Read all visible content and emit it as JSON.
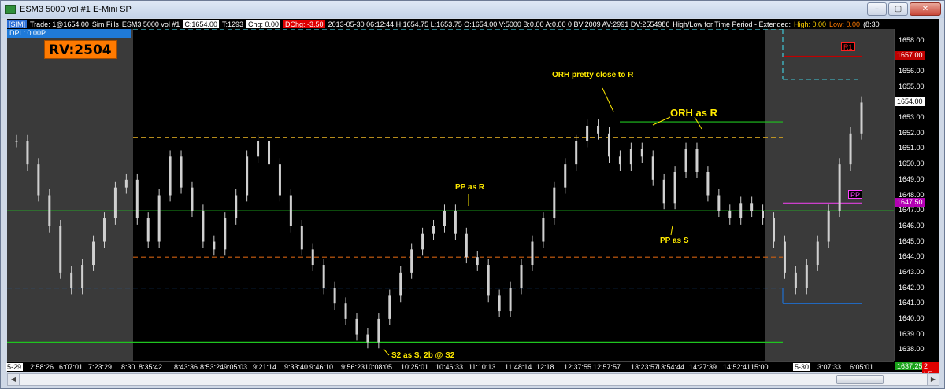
{
  "window": {
    "title": "ESM3  5000 vol  #1  E-Mini SP",
    "buttons": {
      "minimize": "–",
      "maximize": "▢",
      "close": "✕"
    }
  },
  "infobar": {
    "sim": "[SIM]",
    "trade": "Trade: 1@1654.00",
    "fills": "Sim Fills",
    "symbol": "ESM3  5000 vol  #1",
    "close": "C:1654.00",
    "ticks": "T:1293",
    "chg": "Chg: 0.00",
    "dchg": "DChg: -3.50",
    "bar": "2013-05-30 06:12:44 H:1654.75 L:1653.75 O:1654.00 V:5000 B:0.00 A:0.00 0 BV:2009 AV:2991 DV:2554986",
    "hl_label": "High/Low for Time Period - Extended:",
    "high": "High: 0.00",
    "low": "Low: 0.00",
    "tail": "(8:30"
  },
  "dpl": "DPL: 0.00P",
  "rv_badge": "RV:2504",
  "price_axis": {
    "labels": [
      "1658.00",
      "1656.00",
      "1655.00",
      "1653.00",
      "1652.00",
      "1651.00",
      "1650.00",
      "1649.00",
      "1648.00",
      "1647.00",
      "1646.00",
      "1645.00",
      "1644.00",
      "1643.00",
      "1642.00",
      "1641.00",
      "1640.00",
      "1639.00",
      "1638.00"
    ],
    "tags": [
      {
        "name": "r1-tag",
        "text": "R1",
        "color": "#ff2020",
        "bg": "#000"
      },
      {
        "name": "r1-price-tag",
        "text": "1657.00",
        "color": "#fff",
        "bg": "#c00000"
      },
      {
        "name": "last-price-tag",
        "text": "1654.00",
        "color": "#000",
        "bg": "#fff"
      },
      {
        "name": "pp-tag",
        "text": "PP",
        "color": "#ff40ff",
        "bg": "#000"
      },
      {
        "name": "pp-price-tag",
        "text": "1647.50",
        "color": "#fff",
        "bg": "#b400b4"
      }
    ]
  },
  "time_axis": {
    "labels": [
      "5-29",
      "2:58:26",
      "6:07:01",
      "7:23:29",
      "8:30",
      "8:35:42",
      "8:43:36",
      "8:53:24",
      "9:05:03",
      "9:21:14",
      "9:33:40",
      "9:46:10",
      "9:56:23",
      "10:08:05",
      "10:25:01",
      "10:46:33",
      "11:10:13",
      "11:48:14",
      "12:18",
      "12:37:55",
      "12:57:57",
      "13:23:57",
      "13:54:44",
      "14:27:39",
      "14:52:41",
      "15:00",
      "5-30",
      "3:07:33",
      "6:05:01"
    ],
    "corner": [
      {
        "text": "1637.25",
        "color": "#fff",
        "bg": "#1aa31a"
      },
      {
        "text": "2 LE",
        "color": "#fff",
        "bg": "#e00000"
      }
    ]
  },
  "annotations": {
    "orh_close": "ORH pretty close to R",
    "orh_r": "ORH as R",
    "pp_r": "PP as R",
    "pp_s": "PP as S",
    "s2": "S2 as S, 2b @ S2"
  },
  "colors": {
    "background": "#000000",
    "session_shade": "#3a3a3a",
    "candle": "#d0d0d0",
    "pp_line": "#1fc41f",
    "r1_line": "#c08020",
    "s1_line": "#1f6fd0",
    "orange_line": "#d06010",
    "cyan_line": "#40c8d8",
    "magenta_line": "#e040e0"
  },
  "chart_data": {
    "type": "line",
    "title": "ESM3  5000 vol  #1  E-Mini SP",
    "x_categories": [
      "5-29",
      "2:58:26",
      "6:07:01",
      "7:23:29",
      "8:30",
      "8:35:42",
      "8:43:36",
      "8:53:24",
      "9:05:03",
      "9:21:14",
      "9:33:40",
      "9:46:10",
      "9:56:23",
      "10:08:05",
      "10:25:01",
      "10:46:33",
      "11:10:13",
      "11:48:14",
      "12:18",
      "12:37:55",
      "12:57:57",
      "13:23:57",
      "13:54:44",
      "14:27:39",
      "14:52:41",
      "15:00",
      "5-30",
      "3:07:33",
      "6:05:01"
    ],
    "ylim": [
      1637.25,
      1658.75
    ],
    "closes": [
      1651.5,
      1650.0,
      1648.0,
      1646.0,
      1643.0,
      1642.0,
      1643.5,
      1645.0,
      1646.5,
      1648.5,
      1649.0,
      1646.5,
      1645.0,
      1648.0,
      1650.5,
      1648.5,
      1647.0,
      1645.0,
      1644.5,
      1646.5,
      1648.0,
      1650.5,
      1651.5,
      1650.0,
      1648.0,
      1646.0,
      1644.5,
      1643.5,
      1642.0,
      1641.0,
      1640.0,
      1639.0,
      1638.5,
      1640.0,
      1641.5,
      1643.0,
      1644.5,
      1645.5,
      1646.0,
      1647.0,
      1645.5,
      1644.0,
      1643.5,
      1641.5,
      1640.5,
      1642.0,
      1643.5,
      1645.0,
      1646.5,
      1648.5,
      1650.0,
      1651.5,
      1652.5,
      1652.0,
      1650.5,
      1650.0,
      1651.0,
      1650.5,
      1649.0,
      1647.5,
      1649.5,
      1651.0,
      1649.5,
      1648.0,
      1647.0,
      1646.5,
      1647.5,
      1647.0,
      1646.5,
      1645.0,
      1643.0,
      1642.0,
      1643.5,
      1645.0,
      1647.0,
      1650.0,
      1652.0,
      1654.0
    ],
    "levels": [
      {
        "name": "R1",
        "value": 1657.0
      },
      {
        "name": "PP",
        "value": 1647.5
      },
      {
        "name": "ORH",
        "value": 1652.75
      }
    ]
  }
}
